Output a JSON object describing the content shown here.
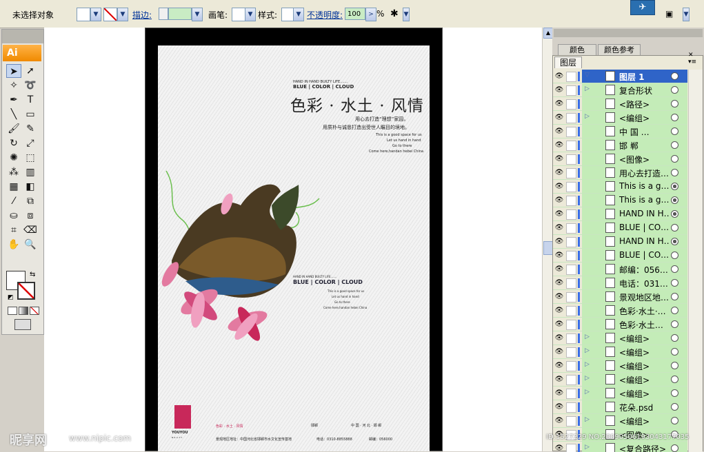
{
  "control_bar": {
    "selection_status": "未选择对象",
    "stroke_label": "描边:",
    "brush_label": "画笔:",
    "style_label": "样式:",
    "opacity_label": "不透明度:",
    "opacity_value": "100",
    "percent": "%"
  },
  "tools": {
    "logo": "Ai",
    "items": [
      {
        "icon": "selection-arrow-icon",
        "glyph": "➤"
      },
      {
        "icon": "direct-selection-icon",
        "glyph": "➚"
      },
      {
        "icon": "magic-wand-icon",
        "glyph": "✧"
      },
      {
        "icon": "lasso-icon",
        "glyph": "➰"
      },
      {
        "icon": "pen-icon",
        "glyph": "✒"
      },
      {
        "icon": "type-icon",
        "glyph": "T"
      },
      {
        "icon": "line-icon",
        "glyph": "╲"
      },
      {
        "icon": "rectangle-icon",
        "glyph": "▭"
      },
      {
        "icon": "paintbrush-icon",
        "glyph": "🖌"
      },
      {
        "icon": "pencil-icon",
        "glyph": "✎"
      },
      {
        "icon": "rotate-icon",
        "glyph": "↻"
      },
      {
        "icon": "scale-icon",
        "glyph": "⤢"
      },
      {
        "icon": "warp-icon",
        "glyph": "✺"
      },
      {
        "icon": "free-transform-icon",
        "glyph": "⬚"
      },
      {
        "icon": "symbol-sprayer-icon",
        "glyph": "⁂"
      },
      {
        "icon": "column-graph-icon",
        "glyph": "▥"
      },
      {
        "icon": "mesh-icon",
        "glyph": "▦"
      },
      {
        "icon": "gradient-icon",
        "glyph": "◧"
      },
      {
        "icon": "eyedropper-icon",
        "glyph": "⁄"
      },
      {
        "icon": "blend-icon",
        "glyph": "⧉"
      },
      {
        "icon": "live-paint-bucket-icon",
        "glyph": "⛀"
      },
      {
        "icon": "live-paint-selection-icon",
        "glyph": "⧈"
      },
      {
        "icon": "crop-area-icon",
        "glyph": "⌗"
      },
      {
        "icon": "eraser-icon",
        "glyph": "⌫"
      },
      {
        "icon": "hand-icon",
        "glyph": "✋"
      },
      {
        "icon": "zoom-icon",
        "glyph": "🔍"
      }
    ]
  },
  "poster": {
    "tagline_small": "HAND IN HAND BUILTY LIFE.......",
    "tagline_brand": "BLUE | COLOR | CLOUD",
    "title": "色彩 · 水土 · 风情",
    "line1": "用心去打造“理想”家园，",
    "line2": "用质朴与诚恳打造出受世人瞩目的境地。",
    "en1": "This is a good space for us",
    "en2": "Let us hand in hand",
    "en3": "Go to there",
    "en4": "Come here,handan hebei China",
    "tagline_small2": "HAND IN HAND BUILTY LIFE.......",
    "tagline_brand2": "BLUE | COLOR | CLOUD",
    "en1b": "This is a good space for us",
    "en2b": "Let us hand in hand",
    "en3b": "Go to there",
    "en4b": "Come here,handan hebei China",
    "logo_text": "YOUYOU",
    "logo_sub": "B U I L T Y",
    "footer_red": "色彩 · 水土 · 风情",
    "footer_stamp1": "邯郸",
    "footer_stamp2": "中 国 · 河 北 · 邯 郸",
    "footer_address": "景观地区地址：中国河北省邯郸市水文化宣传基地",
    "footer_phone": "电话：0310-8855888",
    "footer_postcode": "邮编：056000"
  },
  "layers_panel": {
    "tab_color": "颜色",
    "tab_color_ref": "颜色参考",
    "tab_layers": "图层",
    "rows": [
      {
        "name": "图层 1",
        "expand": "▽",
        "top": true,
        "target": "hollow"
      },
      {
        "name": "复合形状",
        "expand": "▷",
        "target": "hollow"
      },
      {
        "name": "<路径>",
        "expand": "",
        "target": "hollow"
      },
      {
        "name": "<编组>",
        "expand": "▷",
        "target": "hollow"
      },
      {
        "name": "中  国   …",
        "expand": "",
        "target": "hollow"
      },
      {
        "name": "邯   郸",
        "expand": "",
        "target": "hollow"
      },
      {
        "name": "<图像>",
        "expand": "",
        "target": "hollow"
      },
      {
        "name": "用心去打造…",
        "expand": "",
        "target": "hollow"
      },
      {
        "name": "This is a g…",
        "expand": "",
        "target": "filled"
      },
      {
        "name": "This is a g…",
        "expand": "",
        "target": "filled"
      },
      {
        "name": "HAND IN H…",
        "expand": "",
        "target": "filled"
      },
      {
        "name": "BLUE | CO…",
        "expand": "",
        "target": "hollow"
      },
      {
        "name": "HAND IN H…",
        "expand": "",
        "target": "filled"
      },
      {
        "name": "BLUE | CO…",
        "expand": "",
        "target": "hollow"
      },
      {
        "name": "邮编：056…",
        "expand": "",
        "target": "hollow"
      },
      {
        "name": "电话：031…",
        "expand": "",
        "target": "hollow"
      },
      {
        "name": "景观地区地…",
        "expand": "",
        "target": "hollow"
      },
      {
        "name": "色彩·水土·…",
        "expand": "",
        "target": "hollow"
      },
      {
        "name": "色彩·水土…",
        "expand": "",
        "target": "hollow"
      },
      {
        "name": "<编组>",
        "expand": "▷",
        "target": "hollow"
      },
      {
        "name": "<编组>",
        "expand": "▷",
        "target": "hollow"
      },
      {
        "name": "<编组>",
        "expand": "▷",
        "target": "hollow"
      },
      {
        "name": "<编组>",
        "expand": "▷",
        "target": "hollow"
      },
      {
        "name": "<编组>",
        "expand": "▷",
        "target": "hollow"
      },
      {
        "name": "花朵.psd",
        "expand": "",
        "target": "hollow"
      },
      {
        "name": "<编组>",
        "expand": "▷",
        "target": "hollow"
      },
      {
        "name": "<图像>",
        "expand": "",
        "target": "hollow"
      },
      {
        "name": "<复合路径>",
        "expand": "▷",
        "target": "hollow"
      }
    ]
  },
  "watermark": {
    "site_logo": "昵享网",
    "site_url": "www.nipic.com",
    "image_id": "ID:1527229 NO:20090506193043177035"
  },
  "colors": {
    "layer_highlight": "#c4ecb8",
    "selected_layer": "#2f64c8",
    "ai_orange": "#f08a00",
    "poster_red": "#c8285a"
  }
}
